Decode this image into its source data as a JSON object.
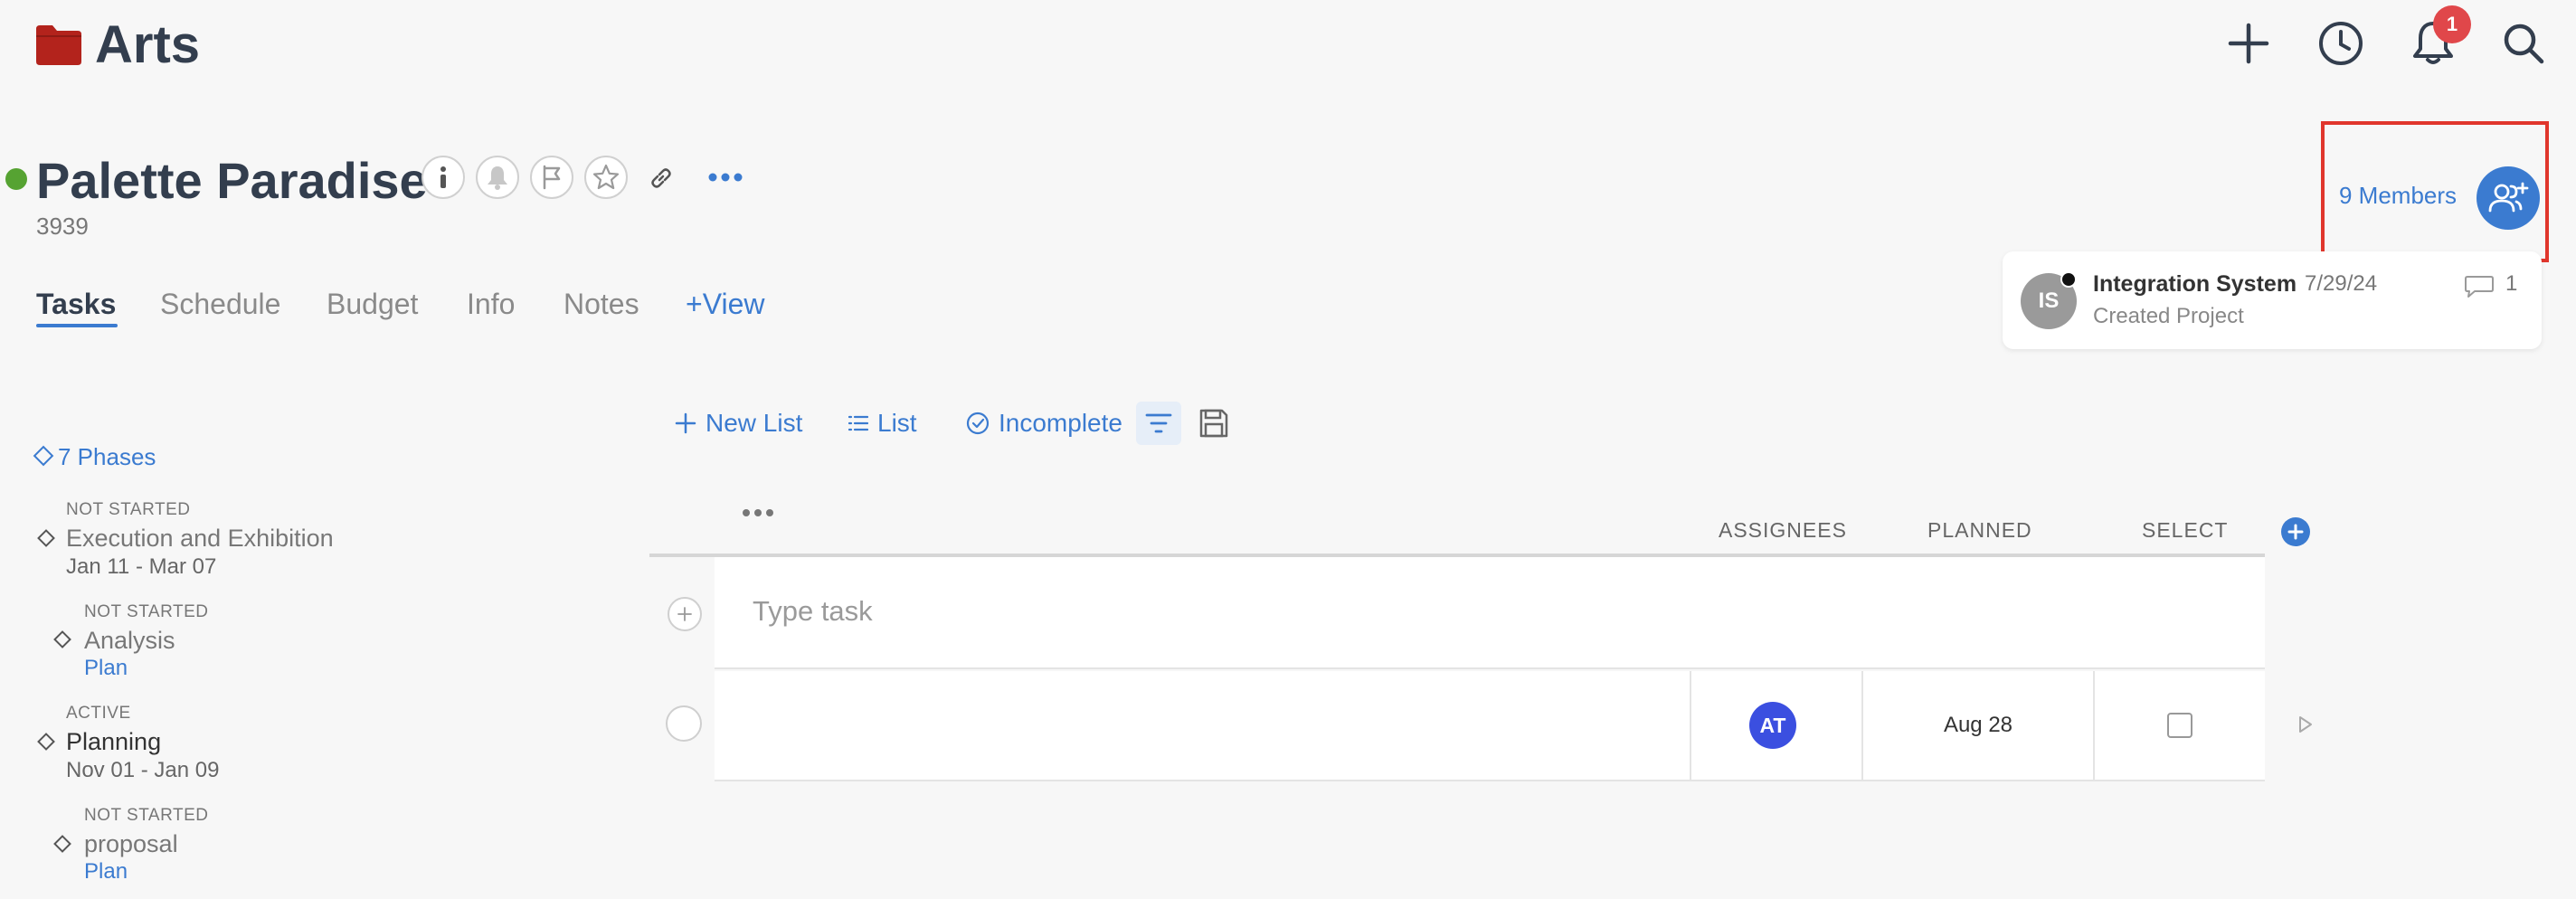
{
  "app": {
    "title": "Arts",
    "notification_count": "1"
  },
  "project": {
    "title": "Palette Paradise",
    "id": "3939",
    "tabs": [
      {
        "label": "Tasks",
        "active": true
      },
      {
        "label": "Schedule"
      },
      {
        "label": "Budget"
      },
      {
        "label": "Info"
      },
      {
        "label": "Notes"
      },
      {
        "label": "+View"
      }
    ]
  },
  "members": {
    "label": "9 Members"
  },
  "activity": {
    "avatar_initials": "IS",
    "name": "Integration System",
    "date": "7/29/24",
    "description": "Created Project",
    "comment_count": "1"
  },
  "toolbar": {
    "new_list": "New List",
    "list": "List",
    "incomplete": "Incomplete"
  },
  "phases": {
    "link": "7 Phases",
    "items": [
      {
        "status": "NOT STARTED",
        "name": "Execution and Exhibition",
        "dates": "Jan 11 - Mar 07"
      },
      {
        "status": "NOT STARTED",
        "name": "Analysis",
        "plan": "Plan"
      },
      {
        "status": "ACTIVE",
        "name": "Planning",
        "dates": "Nov 01 - Jan 09"
      },
      {
        "status": "NOT STARTED",
        "name": "proposal",
        "plan": "Plan"
      }
    ]
  },
  "table": {
    "headers": {
      "assignees": "ASSIGNEES",
      "planned": "PLANNED",
      "select": "SELECT"
    },
    "new_task_placeholder": "Type task",
    "rows": [
      {
        "assignee_initials": "AT",
        "planned": "Aug 28"
      }
    ]
  },
  "colors": {
    "accent": "#3b7bd0",
    "status_active": "#56a332",
    "badge": "#e0474a",
    "highlight": "#e0362c",
    "folder": "#b3231c"
  },
  "icons": [
    "folder-icon",
    "plus-icon",
    "clock-icon",
    "bell-icon",
    "search-icon",
    "info-icon",
    "bell-icon",
    "flag-icon",
    "star-icon",
    "link-icon",
    "more-icon",
    "add-members-icon",
    "comment-icon",
    "plus-icon",
    "list-icon",
    "check-circle-icon",
    "filter-icon",
    "save-icon",
    "diamond-icon",
    "play-icon"
  ]
}
